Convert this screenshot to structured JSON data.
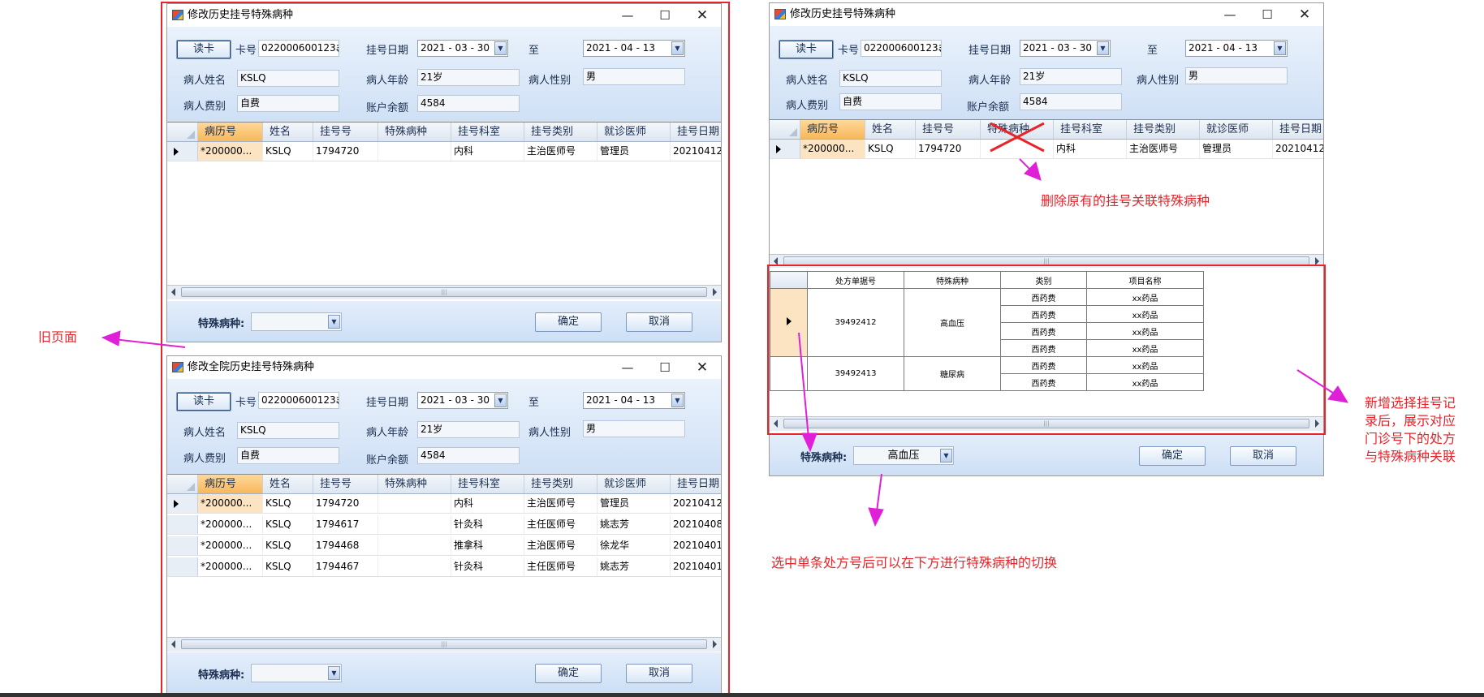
{
  "win_old1": {
    "title": "修改历史挂号特殊病种",
    "min": "—",
    "max": "☐",
    "close": "✕"
  },
  "win_old2": {
    "title": "修改全院历史挂号特殊病种",
    "min": "—",
    "max": "☐",
    "close": "✕"
  },
  "win_new": {
    "title": "修改历史挂号特殊病种",
    "min": "—",
    "max": "☐",
    "close": "✕"
  },
  "form": {
    "read_card": "读卡",
    "card_label": "卡号",
    "card_no": "022000600123३",
    "reg_date_label": "挂号日期",
    "date_from": "2021 - 03 - 30",
    "to_label": "至",
    "date_to": "2021 - 04 - 13",
    "name_label": "病人姓名",
    "name": "KSLQ",
    "age_label": "病人年龄",
    "age": "21岁",
    "gender_label": "病人性别",
    "gender": "男",
    "fee_label": "病人费别",
    "fee": "自费",
    "balance_label": "账户余额",
    "balance": "4584"
  },
  "grid": {
    "columns": [
      "病历号",
      "姓名",
      "挂号号",
      "特殊病种",
      "挂号科室",
      "挂号类别",
      "就诊医师",
      "挂号日期"
    ],
    "rows_single": [
      [
        "*200000...",
        "KSLQ",
        "1794720",
        "",
        "内科",
        "主治医师号",
        "管理员",
        "20210412"
      ]
    ],
    "rows_all": [
      [
        "*200000...",
        "KSLQ",
        "1794720",
        "",
        "内科",
        "主治医师号",
        "管理员",
        "20210412"
      ],
      [
        "*200000...",
        "KSLQ",
        "1794617",
        "",
        "针灸科",
        "主任医师号",
        "姚志芳",
        "20210408"
      ],
      [
        "*200000...",
        "KSLQ",
        "1794468",
        "",
        "推拿科",
        "主治医师号",
        "徐龙华",
        "20210401"
      ],
      [
        "*200000...",
        "KSLQ",
        "1794467",
        "",
        "针灸科",
        "主任医师号",
        "姚志芳",
        "20210401"
      ]
    ]
  },
  "footer": {
    "special_label": "特殊病种:",
    "combo_value_empty": "",
    "combo_value_new": "高血压",
    "ok": "确定",
    "cancel": "取消"
  },
  "sub_table": {
    "headers": [
      "处方单据号",
      "特殊病种",
      "类别",
      "项目名称"
    ],
    "groups": [
      {
        "rx": "39492412",
        "disease": "高血压",
        "items": [
          [
            "西药费",
            "xx药品"
          ],
          [
            "西药费",
            "xx药品"
          ],
          [
            "西药费",
            "xx药品"
          ],
          [
            "西药费",
            "xx药品"
          ]
        ]
      },
      {
        "rx": "39492413",
        "disease": "糖尿病",
        "items": [
          [
            "西药费",
            "xx药品"
          ],
          [
            "西药费",
            "xx药品"
          ]
        ]
      }
    ]
  },
  "notes": {
    "old_page": "旧页面",
    "delete_note": "删除原有的挂号关联特殊病种",
    "new_note_lines": [
      "新增选择挂号记",
      "录后，展示对应",
      "门诊号下的处方",
      "与特殊病种关联"
    ],
    "switch_note": "选中单条处方号后可以在下方进行特殊病种的切换"
  },
  "colors": {
    "accent_red": "#e8232a",
    "arrow_magenta": "#e020d8",
    "header_highlight": "#f7b85a"
  }
}
